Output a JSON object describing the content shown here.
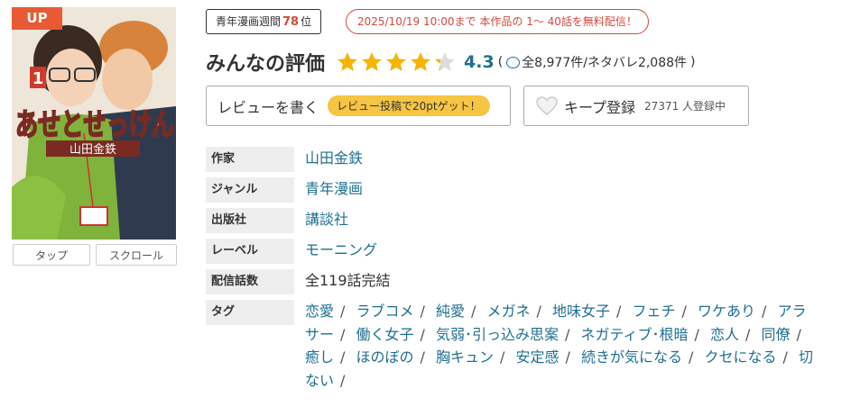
{
  "cover": {
    "badge": "UP",
    "title_art": "あせとせっけん",
    "volume": "1",
    "author_art": "山田金鉄",
    "buttons": [
      "タップ",
      "スクロール"
    ]
  },
  "ranking": {
    "prefix": "青年漫画週間",
    "number": "78",
    "suffix": "位"
  },
  "free_notice": "2025/10/19 10:00まで 本作品の 1～ 40話を無料配信！",
  "rating": {
    "title": "みんなの評価",
    "value": "4.3",
    "stars_filled_fraction": 0.86,
    "count_open": "(",
    "count_text": "全8,977件/ネタバレ2,088件",
    "count_close": ")",
    "star_color": "#f5b400",
    "value_color": "#1f6f91"
  },
  "actions": {
    "review_label": "レビューを書く",
    "review_pill": "レビュー投稿で20ptゲット！",
    "keep_label": "キープ登録",
    "keep_count": "27371 人登録中"
  },
  "details": [
    {
      "label": "作家",
      "value": "山田金鉄"
    },
    {
      "label": "ジャンル",
      "value": "青年漫画"
    },
    {
      "label": "出版社",
      "value": "講談社"
    },
    {
      "label": "レーベル",
      "value": "モーニング"
    },
    {
      "label": "配信話数",
      "value": "全119話完結"
    }
  ],
  "tags_label": "タグ",
  "tags": [
    "恋愛",
    "ラブコメ",
    "純愛",
    "メガネ",
    "地味女子",
    "フェチ",
    "ワケあり",
    "アラサー",
    "働く女子",
    "気弱･引っ込み思案",
    "ネガティブ･根暗",
    "恋人",
    "同僚",
    "癒し",
    "ほのぼの",
    "胸キュン",
    "安定感",
    "続きが気になる",
    "クセになる",
    "切ない"
  ],
  "colors": {
    "link": "#1f6f91",
    "accent_red": "#d4493d",
    "up_badge": "#e85a34",
    "pill": "#f5c543"
  }
}
